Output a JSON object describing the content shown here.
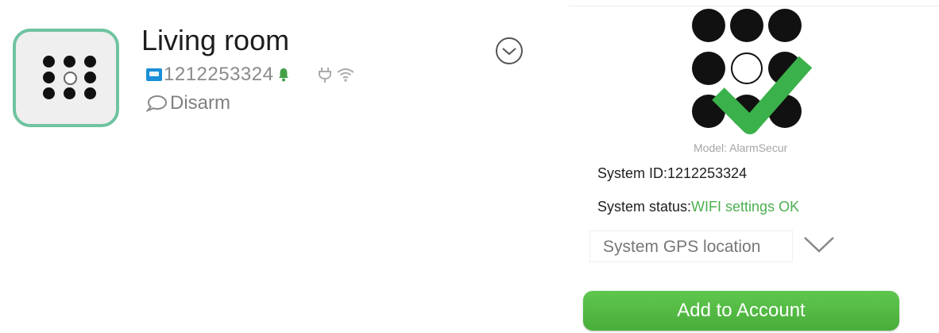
{
  "device": {
    "name": "Living room",
    "id": "1212253324",
    "status": "Disarm"
  },
  "panel": {
    "model_label": "Model: AlarmSecur",
    "system_id_label": "System ID:",
    "system_id_value": "1212253324",
    "system_status_label": "System status:",
    "system_status_value": "WIFI settings OK",
    "gps_placeholder": "System GPS location",
    "add_button_label": "Add to Account"
  },
  "colors": {
    "accent_green": "#4caf50",
    "icon_border": "#6fc3a0",
    "id_badge": "#1b8fd8"
  },
  "icons": [
    "keypad-icon",
    "id-badge-icon",
    "bell-icon",
    "plug-icon",
    "wifi-icon",
    "chat-bubble-icon",
    "expand-chevron-icon",
    "checkmark-logo-icon",
    "chevron-down-icon"
  ]
}
